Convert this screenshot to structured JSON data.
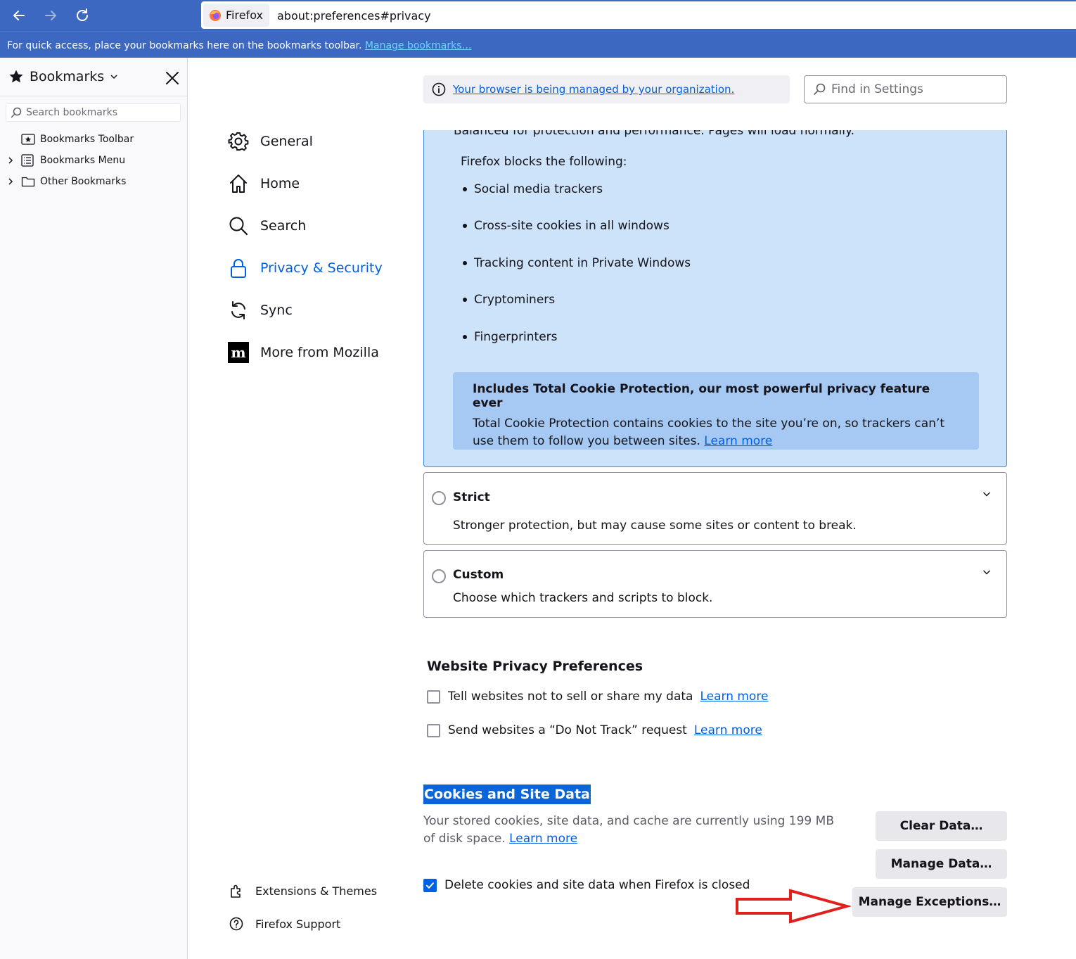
{
  "browser": {
    "identity_label": "Firefox",
    "url": "about:preferences#privacy",
    "bookmarks_bar_message": "For quick access, place your bookmarks here on the bookmarks toolbar.",
    "bookmarks_bar_link": "Manage bookmarks…"
  },
  "sidebar": {
    "title": "Bookmarks",
    "search_placeholder": "Search bookmarks",
    "items": [
      {
        "label": "Bookmarks Toolbar",
        "expandable": false
      },
      {
        "label": "Bookmarks Menu",
        "expandable": true
      },
      {
        "label": "Other Bookmarks",
        "expandable": true
      }
    ]
  },
  "categories": [
    {
      "label": "General",
      "icon": "gear-icon",
      "selected": false
    },
    {
      "label": "Home",
      "icon": "home-icon",
      "selected": false
    },
    {
      "label": "Search",
      "icon": "search-icon",
      "selected": false
    },
    {
      "label": "Privacy & Security",
      "icon": "lock-icon",
      "selected": true
    },
    {
      "label": "Sync",
      "icon": "sync-icon",
      "selected": false
    },
    {
      "label": "More from Mozilla",
      "icon": "mozilla-icon",
      "selected": false
    }
  ],
  "footer_links": [
    {
      "label": "Extensions & Themes",
      "icon": "puzzle-icon"
    },
    {
      "label": "Firefox Support",
      "icon": "help-icon"
    }
  ],
  "policies": {
    "message": "Your browser is being managed by your organization."
  },
  "find_in_settings": {
    "placeholder": "Find in Settings"
  },
  "standard": {
    "description": "Balanced for protection and performance. Pages will load normally.",
    "blocks_title": "Firefox blocks the following:",
    "blocks": [
      "Social media trackers",
      "Cross-site cookies in all windows",
      "Tracking content in Private Windows",
      "Cryptominers",
      "Fingerprinters"
    ],
    "tcp_title": "Includes Total Cookie Protection, our most powerful privacy feature ever",
    "tcp_body": "Total Cookie Protection contains cookies to the site you’re on, so trackers can’t use them to follow you between sites.",
    "tcp_link": "Learn more"
  },
  "strict": {
    "title": "Strict",
    "description": "Stronger protection, but may cause some sites or content to break.",
    "selected": false
  },
  "custom": {
    "title": "Custom",
    "description": "Choose which trackers and scripts to block.",
    "selected": false
  },
  "website_privacy": {
    "title": "Website Privacy Preferences",
    "options": [
      {
        "label": "Tell websites not to sell or share my data",
        "checked": false,
        "link": "Learn more"
      },
      {
        "label": "Send websites a “Do Not Track” request",
        "checked": false,
        "link": "Learn more"
      }
    ]
  },
  "cookies": {
    "title": "Cookies and Site Data",
    "description": "Your stored cookies, site data, and cache are currently using 199 MB of disk space.",
    "link": "Learn more",
    "delete_on_close_label": "Delete cookies and site data when Firefox is closed",
    "delete_on_close_checked": true,
    "clear_data_button": "Clear Data…",
    "manage_data_button": "Manage Data…",
    "manage_exceptions_button": "Manage Exceptions…"
  },
  "colors": {
    "accent": "#0061e0",
    "toolbar": "#3d68c1",
    "selection": "#0a65d8",
    "annotation_arrow": "#e0201b"
  }
}
